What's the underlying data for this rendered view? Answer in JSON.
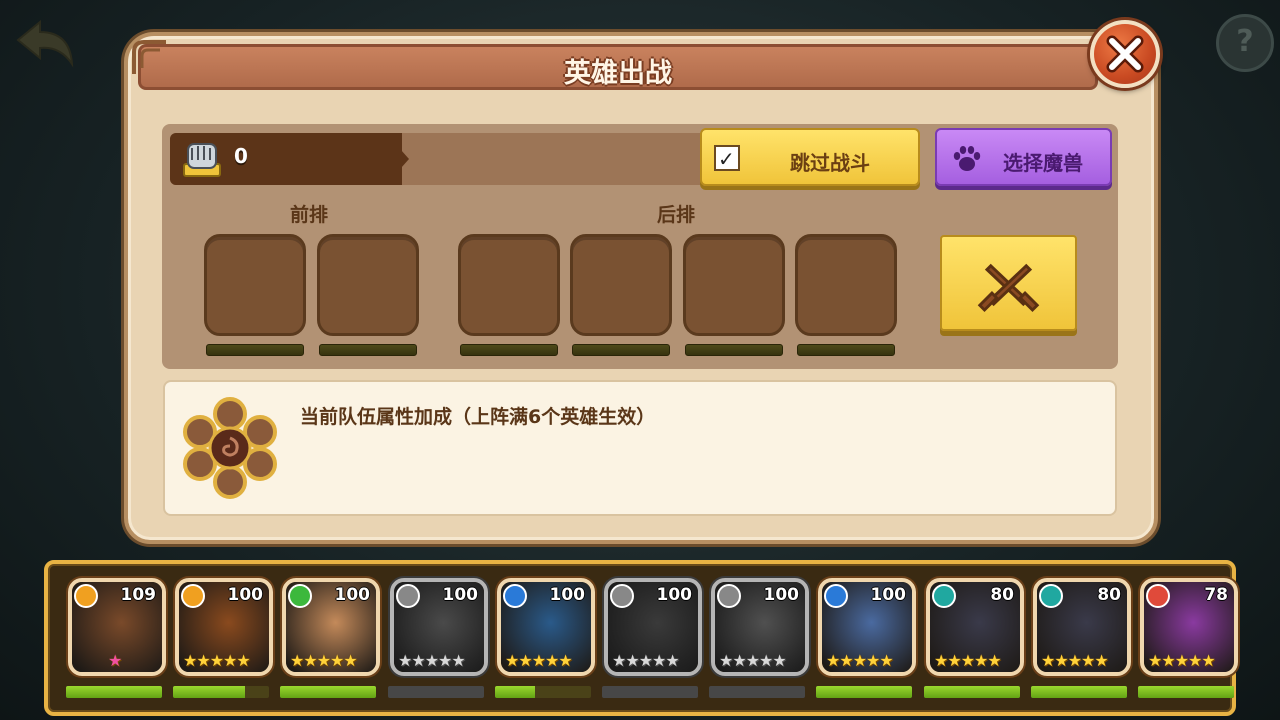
{
  "dialog": {
    "title": "英雄出战",
    "power_value": "0",
    "skip_battle_label": "跳过战斗",
    "skip_battle_checked": true,
    "select_beast_label": "选择魔兽",
    "front_row_label": "前排",
    "back_row_label": "后排",
    "bonus_text": "当前队伍属性加成（上阵满6个英雄生效）"
  },
  "colors": {
    "panel": "#e9d4b3",
    "title_bar": "#c9825e",
    "yellow_button": "#f0c43a",
    "purple_button": "#a55fe0",
    "hp_green": "#7cc41f"
  },
  "heroes": [
    {
      "level": "109",
      "stars": "★",
      "element": "fire",
      "elem_color": "#f0a020",
      "hp": 1.0,
      "gray": false,
      "art": "#7a4a2a",
      "star_pink": true
    },
    {
      "level": "100",
      "stars": "★★★★★",
      "element": "fire",
      "elem_color": "#f0a020",
      "hp": 0.75,
      "gray": false,
      "art": "#8a4a1e"
    },
    {
      "level": "100",
      "stars": "★★★★★",
      "element": "nature",
      "elem_color": "#3cb83c",
      "hp": 1.0,
      "gray": false,
      "art": "#c48a5a"
    },
    {
      "level": "100",
      "stars": "★★★★★",
      "element": "wind",
      "elem_color": "#888888",
      "hp": 0.0,
      "gray": true,
      "art": "#4a4a4a"
    },
    {
      "level": "100",
      "stars": "★★★★★",
      "element": "holy",
      "elem_color": "#2a7ad8",
      "hp": 0.42,
      "gray": false,
      "art": "#2a5a8a"
    },
    {
      "level": "100",
      "stars": "★★★★★",
      "element": "holy",
      "elem_color": "#888888",
      "hp": 0.0,
      "gray": true,
      "art": "#3a3a3a"
    },
    {
      "level": "100",
      "stars": "★★★★★",
      "element": "holy",
      "elem_color": "#888888",
      "hp": 0.0,
      "gray": true,
      "art": "#505050"
    },
    {
      "level": "100",
      "stars": "★★★★★",
      "element": "holy",
      "elem_color": "#2a7ad8",
      "hp": 1.0,
      "gray": false,
      "art": "#4a6aa0"
    },
    {
      "level": "80",
      "stars": "★★★★★",
      "element": "death",
      "elem_color": "#20a8a0",
      "hp": 1.0,
      "gray": false,
      "art": "#3a3a4a"
    },
    {
      "level": "80",
      "stars": "★★★★★",
      "element": "death",
      "elem_color": "#20a8a0",
      "hp": 1.0,
      "gray": false,
      "art": "#3a3a4a"
    },
    {
      "level": "78",
      "stars": "★★★★★",
      "element": "chaos",
      "elem_color": "#e04a3a",
      "hp": 1.0,
      "gray": false,
      "art": "#8a3aa0"
    }
  ]
}
